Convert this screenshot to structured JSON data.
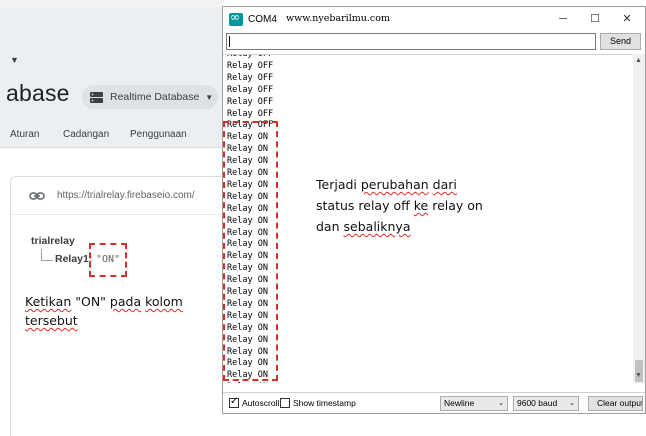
{
  "firebase": {
    "page_title": "abase",
    "db_selector": "Realtime Database",
    "tabs": [
      "Aturan",
      "Cadangan",
      "Penggunaan"
    ],
    "url": "https://trialrelay.firebaseio.com/",
    "root_key": "trialrelay",
    "child_key": "Relay1:",
    "child_value": "\"ON\""
  },
  "annotations": {
    "left_note_words": [
      "Ketikan",
      "\"ON\"",
      "pada",
      "kolom",
      "tersebut"
    ],
    "right_note_line1": [
      "Terjadi",
      "perubahan",
      "dari"
    ],
    "right_note_line2": [
      "status",
      "relay",
      "off",
      "ke",
      "relay",
      "on"
    ],
    "right_note_line3": [
      "dan",
      "sebaliknya"
    ]
  },
  "serial_monitor": {
    "window_title": "COM4",
    "site_label": "www.nyebarilmu.com",
    "send_input_value": "",
    "send_button": "Send",
    "output_lines": [
      "Relay OFF",
      "Relay OFF",
      "Relay OFF",
      "Relay OFF",
      "Relay OFF",
      "Relay OFF",
      "Relay OFF",
      "Relay ON",
      "Relay ON",
      "Relay ON",
      "Relay ON",
      "Relay ON",
      "Relay ON",
      "Relay ON",
      "Relay ON",
      "Relay ON",
      "Relay ON",
      "Relay ON",
      "Relay ON",
      "Relay ON",
      "Relay ON",
      "Relay ON",
      "Relay ON",
      "Relay ON",
      "Relay ON",
      "Relay ON",
      "Relay ON",
      "Relay ON",
      "Relay ON"
    ],
    "autoscroll_label": "Autoscroll",
    "autoscroll_checked": true,
    "timestamp_label": "Show timestamp",
    "timestamp_checked": false,
    "line_ending": "Newline",
    "baud_rate": "9600 baud",
    "clear_button": "Clear output"
  },
  "colors": {
    "annotation_red": "#d32f2f",
    "arduino_teal": "#00979c"
  }
}
